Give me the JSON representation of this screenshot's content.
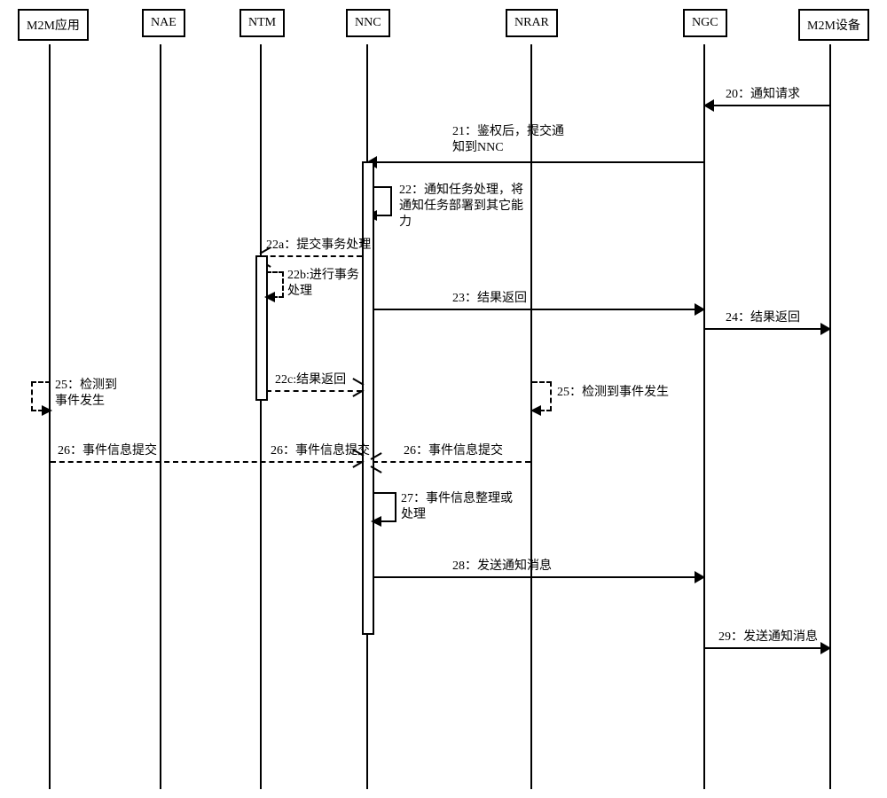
{
  "participants": {
    "p0": "M2M应用",
    "p1": "NAE",
    "p2": "NTM",
    "p3": "NNC",
    "p4": "NRAR",
    "p5": "NGC",
    "p6": "M2M设备"
  },
  "messages": {
    "m20": "20：通知请求",
    "m21a": "21：鉴权后，提交通",
    "m21b": "知到NNC",
    "m22a": "22：通知任务处理，将",
    "m22b": "通知任务部署到其它能",
    "m22c": "力",
    "m22sa": "22a：提交事务处理",
    "m22sb_a": "22b:进行事务",
    "m22sb_b": "处理",
    "m22sc": "22c:结果返回",
    "m23": "23：结果返回",
    "m24": "24：结果返回",
    "m25a": "25：检测到",
    "m25b": "事件发生",
    "m25r": "25：检测到事件发生",
    "m26": "26：事件信息提交",
    "m27a": "27：事件信息整理或",
    "m27b": "处理",
    "m28": "28：发送通知消息",
    "m29": "29：发送通知消息"
  }
}
